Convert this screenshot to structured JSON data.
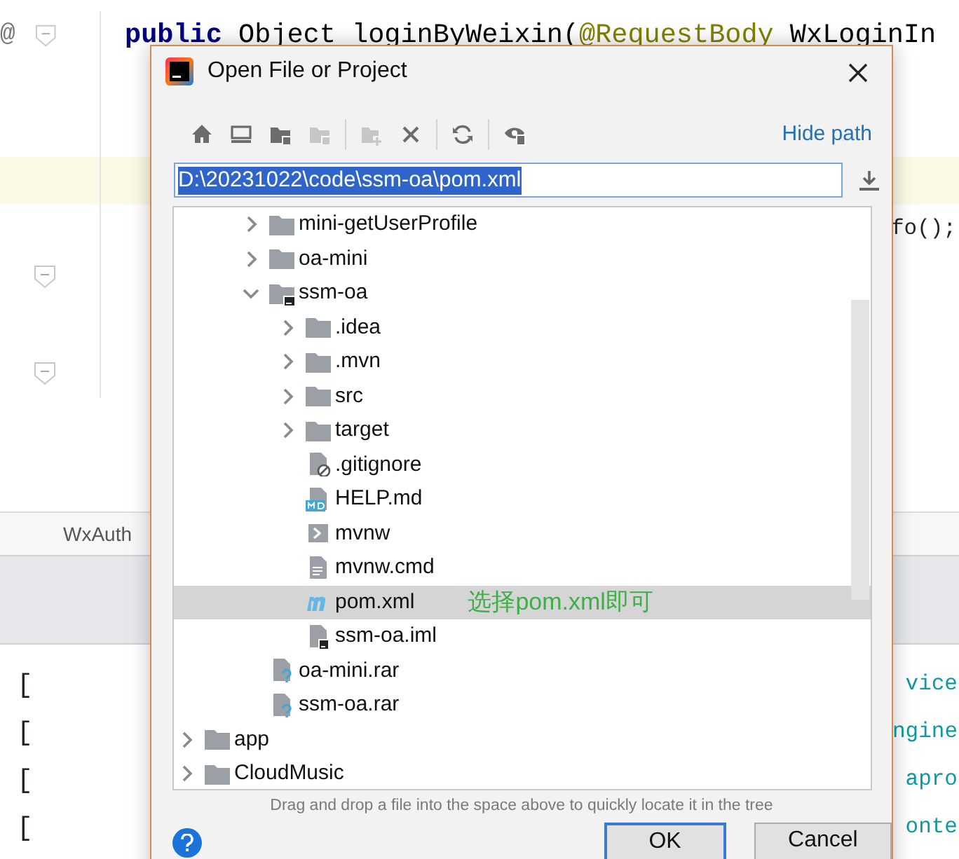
{
  "editor": {
    "lines": [
      {
        "gutter": "@",
        "fold": true,
        "current": false,
        "tokens": [
          {
            "text": "public",
            "kind": "keyword"
          },
          {
            "text": " Object loginByWeixin(",
            "kind": "plain"
          },
          {
            "text": "@RequestBody",
            "kind": "annotation"
          },
          {
            "text": " WxLoginIn",
            "kind": "plain"
          }
        ]
      },
      {
        "fold": false,
        "current": false
      },
      {
        "fold": false,
        "current": false
      },
      {
        "fold": false,
        "current": true
      },
      {
        "fold": false,
        "current": false,
        "tail": "fo();"
      },
      {
        "fold": true,
        "current": false
      },
      {
        "fold": false,
        "current": false
      },
      {
        "fold": true,
        "current": false
      }
    ]
  },
  "editor_tab": "WxAuth",
  "console": [
    {
      "left": "[",
      "right": "vice"
    },
    {
      "left": "[",
      "right": "ngine"
    },
    {
      "left": "[",
      "right": "apro"
    },
    {
      "left": "[",
      "right": "onte"
    }
  ],
  "dialog": {
    "title": "Open File or Project",
    "toolbar": [
      {
        "kind": "home",
        "disabled": false
      },
      {
        "kind": "desktop",
        "disabled": false
      },
      {
        "kind": "project",
        "disabled": false
      },
      {
        "kind": "module",
        "disabled": true
      },
      {
        "kind": "sep"
      },
      {
        "kind": "new-folder",
        "disabled": true
      },
      {
        "kind": "delete",
        "disabled": false
      },
      {
        "kind": "sep"
      },
      {
        "kind": "refresh",
        "disabled": false
      },
      {
        "kind": "sep"
      },
      {
        "kind": "hidden",
        "disabled": false
      }
    ],
    "hide_path": "Hide path",
    "path": "D:\\20231022\\code\\ssm-oa\\pom.xml",
    "tree": [
      {
        "children": [
          {
            "children": [
              {
                "label": "mini-getUserProfile",
                "kind": "folder",
                "expanded": false,
                "selected": false
              },
              {
                "label": "oa-mini",
                "kind": "folder",
                "expanded": false,
                "selected": false
              },
              {
                "label": "ssm-oa",
                "kind": "module",
                "expanded": true,
                "selected": false,
                "children": [
                  {
                    "label": ".idea",
                    "kind": "folder",
                    "expanded": false,
                    "selected": false
                  },
                  {
                    "label": ".mvn",
                    "kind": "folder",
                    "expanded": false,
                    "selected": false
                  },
                  {
                    "label": "src",
                    "kind": "folder",
                    "expanded": false,
                    "selected": false
                  },
                  {
                    "label": "target",
                    "kind": "folder",
                    "expanded": false,
                    "selected": false
                  },
                  {
                    "label": ".gitignore",
                    "kind": "ignored",
                    "selected": false
                  },
                  {
                    "label": "HELP.md",
                    "kind": "markdown",
                    "selected": false
                  },
                  {
                    "label": "mvnw",
                    "kind": "shell",
                    "selected": false
                  },
                  {
                    "label": "mvnw.cmd",
                    "kind": "text",
                    "selected": false
                  },
                  {
                    "label": "pom.xml",
                    "kind": "maven",
                    "selected": true,
                    "note": "选择pom.xml即可"
                  },
                  {
                    "label": "ssm-oa.iml",
                    "kind": "iml",
                    "selected": false
                  }
                ]
              },
              {
                "label": "oa-mini.rar",
                "kind": "unknown",
                "selected": false
              },
              {
                "label": "ssm-oa.rar",
                "kind": "unknown",
                "selected": false
              }
            ]
          }
        ]
      },
      {
        "label": "app",
        "kind": "folder",
        "expanded": false,
        "selected": false
      },
      {
        "label": "CloudMusic",
        "kind": "folder",
        "expanded": false,
        "selected": false
      }
    ],
    "hint": "Drag and drop a file into the space above to quickly locate it in the tree",
    "buttons": [
      {
        "label": "OK",
        "kind": "default"
      },
      {
        "label": "Cancel",
        "kind": "plain"
      }
    ]
  }
}
